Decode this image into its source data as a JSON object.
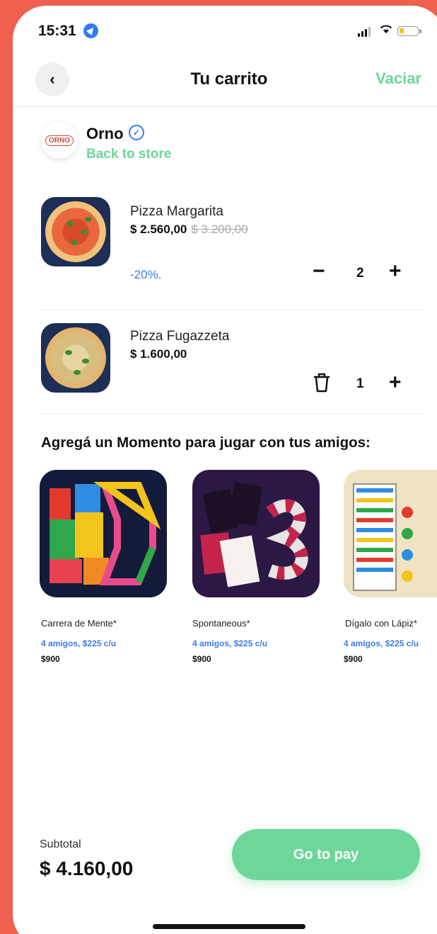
{
  "status_bar": {
    "time": "15:31"
  },
  "header": {
    "title": "Tu carrito",
    "clear_label": "Vaciar",
    "back_icon": "‹"
  },
  "store": {
    "logo_text": "ORNO",
    "name": "Orno",
    "back_label": "Back to store"
  },
  "cart": {
    "items": [
      {
        "name": "Pizza Margarita",
        "price": "$ 2.560,00",
        "old_price": "$ 3.200,00",
        "discount": "-20%.",
        "quantity": "2"
      },
      {
        "name": "Pizza Fugazzeta",
        "price": "$ 1.600,00",
        "quantity": "1"
      }
    ]
  },
  "momentos": {
    "title": "Agregá un Momento para jugar con tus amigos:",
    "games": [
      {
        "name": "Carrera de Mente*",
        "players": "4 amigos, $225 c/u",
        "price": "$900"
      },
      {
        "name": "Spontaneous*",
        "players": "4 amigos, $225 c/u",
        "price": "$900"
      },
      {
        "name": "Dígalo con Lápiz*",
        "players": "4 amigos, $225 c/u",
        "price": "$900"
      }
    ]
  },
  "footer": {
    "subtotal_label": "Subtotal",
    "subtotal_value": "$ 4.160,00",
    "pay_label": "Go to pay"
  },
  "colors": {
    "accent_green": "#6dd699",
    "link_blue": "#3a7bf0",
    "background": "#f0604e"
  }
}
